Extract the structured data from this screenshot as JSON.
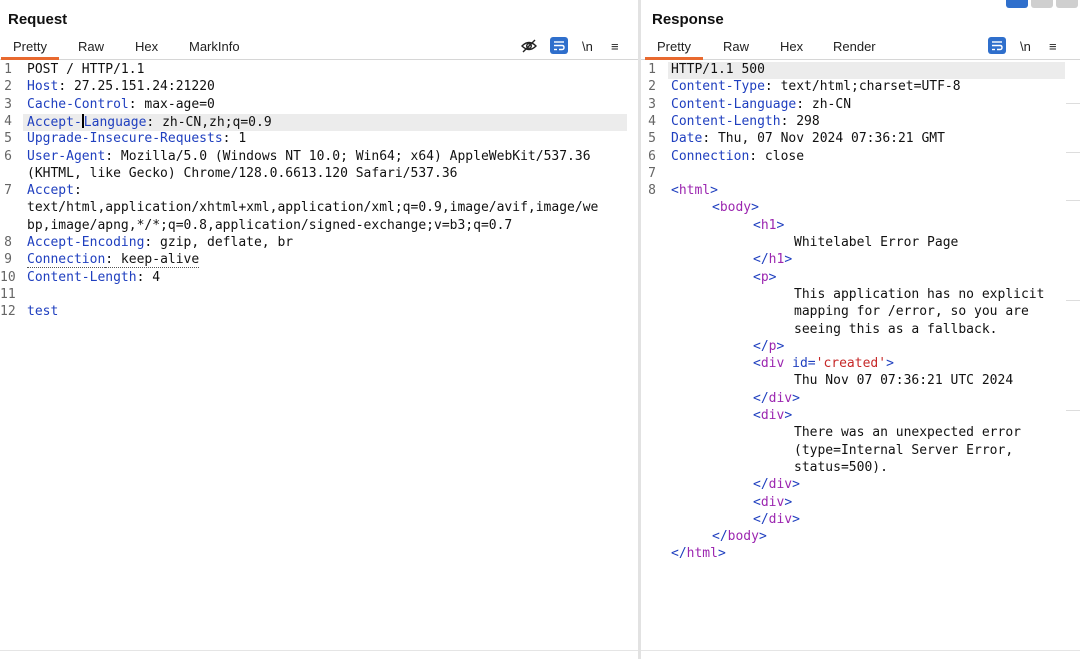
{
  "request": {
    "title": "Request",
    "tabs": [
      "Pretty",
      "Raw",
      "Hex",
      "MarkInfo"
    ],
    "active_tab": "Pretty",
    "tools": {
      "wrap_label": "⤶",
      "newline_label": "\\n",
      "menu_label": "≡"
    },
    "highlight_line": 4,
    "lines": [
      {
        "n": "1",
        "k": "",
        "v": "POST / HTTP/1.1"
      },
      {
        "n": "2",
        "k": "Host",
        "v": ": 27.25.151.24:21220"
      },
      {
        "n": "3",
        "k": "Cache-Control",
        "v": ": max-age=0"
      },
      {
        "n": "4",
        "k": "Accept-Language",
        "v": ": zh-CN,zh;q=0.9"
      },
      {
        "n": "5",
        "k": "Upgrade-Insecure-Requests",
        "v": ": 1"
      },
      {
        "n": "6",
        "k": "User-Agent",
        "v": ": Mozilla/5.0 (Windows NT 10.0; Win64; x64) AppleWebKit/537.36"
      },
      {
        "n": "",
        "k": "",
        "v": "(KHTML, like Gecko) Chrome/128.0.6613.120 Safari/537.36"
      },
      {
        "n": "7",
        "k": "Accept",
        "v": ":"
      },
      {
        "n": "",
        "k": "",
        "v": "text/html,application/xhtml+xml,application/xml;q=0.9,image/avif,image/we"
      },
      {
        "n": "",
        "k": "",
        "v": "bp,image/apng,*/*;q=0.8,application/signed-exchange;v=b3;q=0.7"
      },
      {
        "n": "8",
        "k": "Accept-Encoding",
        "v": ": gzip, deflate, br"
      },
      {
        "n": "9",
        "k": "Connection",
        "v": ": keep-alive"
      },
      {
        "n": "10",
        "k": "Content-Length",
        "v": ": 4"
      },
      {
        "n": "11",
        "k": "",
        "v": ""
      },
      {
        "n": "12",
        "k": "",
        "v": "test",
        "body": true
      }
    ]
  },
  "response": {
    "title": "Response",
    "tabs": [
      "Pretty",
      "Raw",
      "Hex",
      "Render"
    ],
    "active_tab": "Pretty",
    "tools": {
      "wrap_label": "⤶",
      "newline_label": "\\n",
      "menu_label": "≡"
    },
    "header_lines": [
      {
        "n": "1",
        "k": "",
        "v": "HTTP/1.1 500"
      },
      {
        "n": "2",
        "k": "Content-Type",
        "v": ": text/html;charset=UTF-8"
      },
      {
        "n": "3",
        "k": "Content-Language",
        "v": ": zh-CN"
      },
      {
        "n": "4",
        "k": "Content-Length",
        "v": ": 298"
      },
      {
        "n": "5",
        "k": "Date",
        "v": ": Thu, 07 Nov 2024 07:36:21 GMT"
      },
      {
        "n": "6",
        "k": "Connection",
        "v": ": close"
      },
      {
        "n": "7",
        "k": "",
        "v": ""
      }
    ],
    "body_line_number": "8",
    "html_lines": [
      {
        "indent": 0,
        "open": "<",
        "tag": "html",
        "close": ">"
      },
      {
        "indent": 1,
        "open": "<",
        "tag": "body",
        "close": ">"
      },
      {
        "indent": 2,
        "open": "<",
        "tag": "h1",
        "close": ">"
      },
      {
        "indent": 3,
        "text": "Whitelabel Error Page"
      },
      {
        "indent": 2,
        "open": "</",
        "tag": "h1",
        "close": ">"
      },
      {
        "indent": 2,
        "open": "<",
        "tag": "p",
        "close": ">"
      },
      {
        "indent": 3,
        "text": "This application has no explicit"
      },
      {
        "indent": 3,
        "text": "mapping for /error, so you are"
      },
      {
        "indent": 3,
        "text": "seeing this as a fallback."
      },
      {
        "indent": 2,
        "open": "</",
        "tag": "p",
        "close": ">"
      },
      {
        "indent": 2,
        "open": "<",
        "tag": "div",
        "attr": " id=",
        "val": "'created'",
        "close": ">"
      },
      {
        "indent": 3,
        "text": "Thu Nov 07 07:36:21 UTC 2024"
      },
      {
        "indent": 2,
        "open": "</",
        "tag": "div",
        "close": ">"
      },
      {
        "indent": 2,
        "open": "<",
        "tag": "div",
        "close": ">"
      },
      {
        "indent": 3,
        "text": "There was an unexpected error"
      },
      {
        "indent": 3,
        "text": "(type=Internal Server Error,"
      },
      {
        "indent": 3,
        "text": "status=500)."
      },
      {
        "indent": 2,
        "open": "</",
        "tag": "div",
        "close": ">"
      },
      {
        "indent": 2,
        "open": "<",
        "tag": "div",
        "close": ">"
      },
      {
        "indent": 2,
        "open": "</",
        "tag": "div",
        "close": ">"
      },
      {
        "indent": 1,
        "open": "</",
        "tag": "body",
        "close": ">"
      },
      {
        "indent": 0,
        "open": "</",
        "tag": "html",
        "close": ">"
      }
    ]
  },
  "layout_buttons": [
    "split-vertical",
    "split-horizontal",
    "tabs-view"
  ],
  "colors": {
    "accent": "#e8692f",
    "tool_blue": "#2f6fcc",
    "header_key": "#1f3fbf",
    "tag_name": "#9c27b0",
    "attr_value": "#c62828"
  }
}
